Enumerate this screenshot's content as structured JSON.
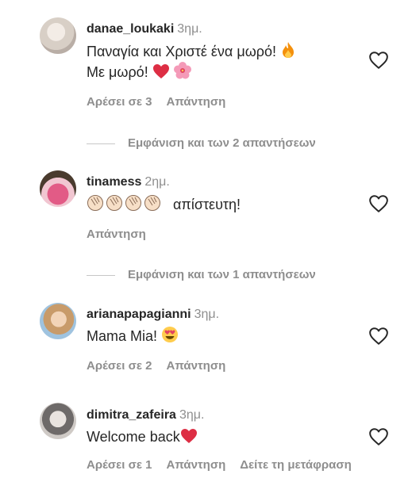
{
  "comments": [
    {
      "username": "danae_loukaki",
      "time": "3ημ.",
      "line1": "Παναγία και Χριστέ ένα μωρό!",
      "line2": "Με μωρό!",
      "likes": "Αρέσει σε 3",
      "reply": "Απάντηση",
      "view_replies": "Εμφάνιση και των 2 απαντήσεων"
    },
    {
      "username": "tinamess",
      "time": "2ημ.",
      "line1": "απίστευτη!",
      "reply": "Απάντηση",
      "view_replies": "Εμφάνιση και των 1 απαντήσεων"
    },
    {
      "username": "arianapapagianni",
      "time": "3ημ.",
      "line1": "Mama Mia!",
      "likes": "Αρέσει σε 2",
      "reply": "Απάντηση"
    },
    {
      "username": "dimitra_zafeira",
      "time": "3ημ.",
      "line1": "Welcome back",
      "likes": "Αρέσει σε 1",
      "reply": "Απάντηση",
      "translate": "Δείτε τη μετάφραση"
    }
  ],
  "icons": {
    "like": "heart-outline-icon",
    "fire": "fire-emoji",
    "red_heart": "red-heart-emoji",
    "flower": "hibiscus-emoji",
    "clap": "clapping-hands-emoji",
    "star_eyes": "heart-eyes-emoji"
  },
  "colors": {
    "text": "#262626",
    "muted": "#8e8e8e",
    "emoji_red": "#e0245e"
  }
}
